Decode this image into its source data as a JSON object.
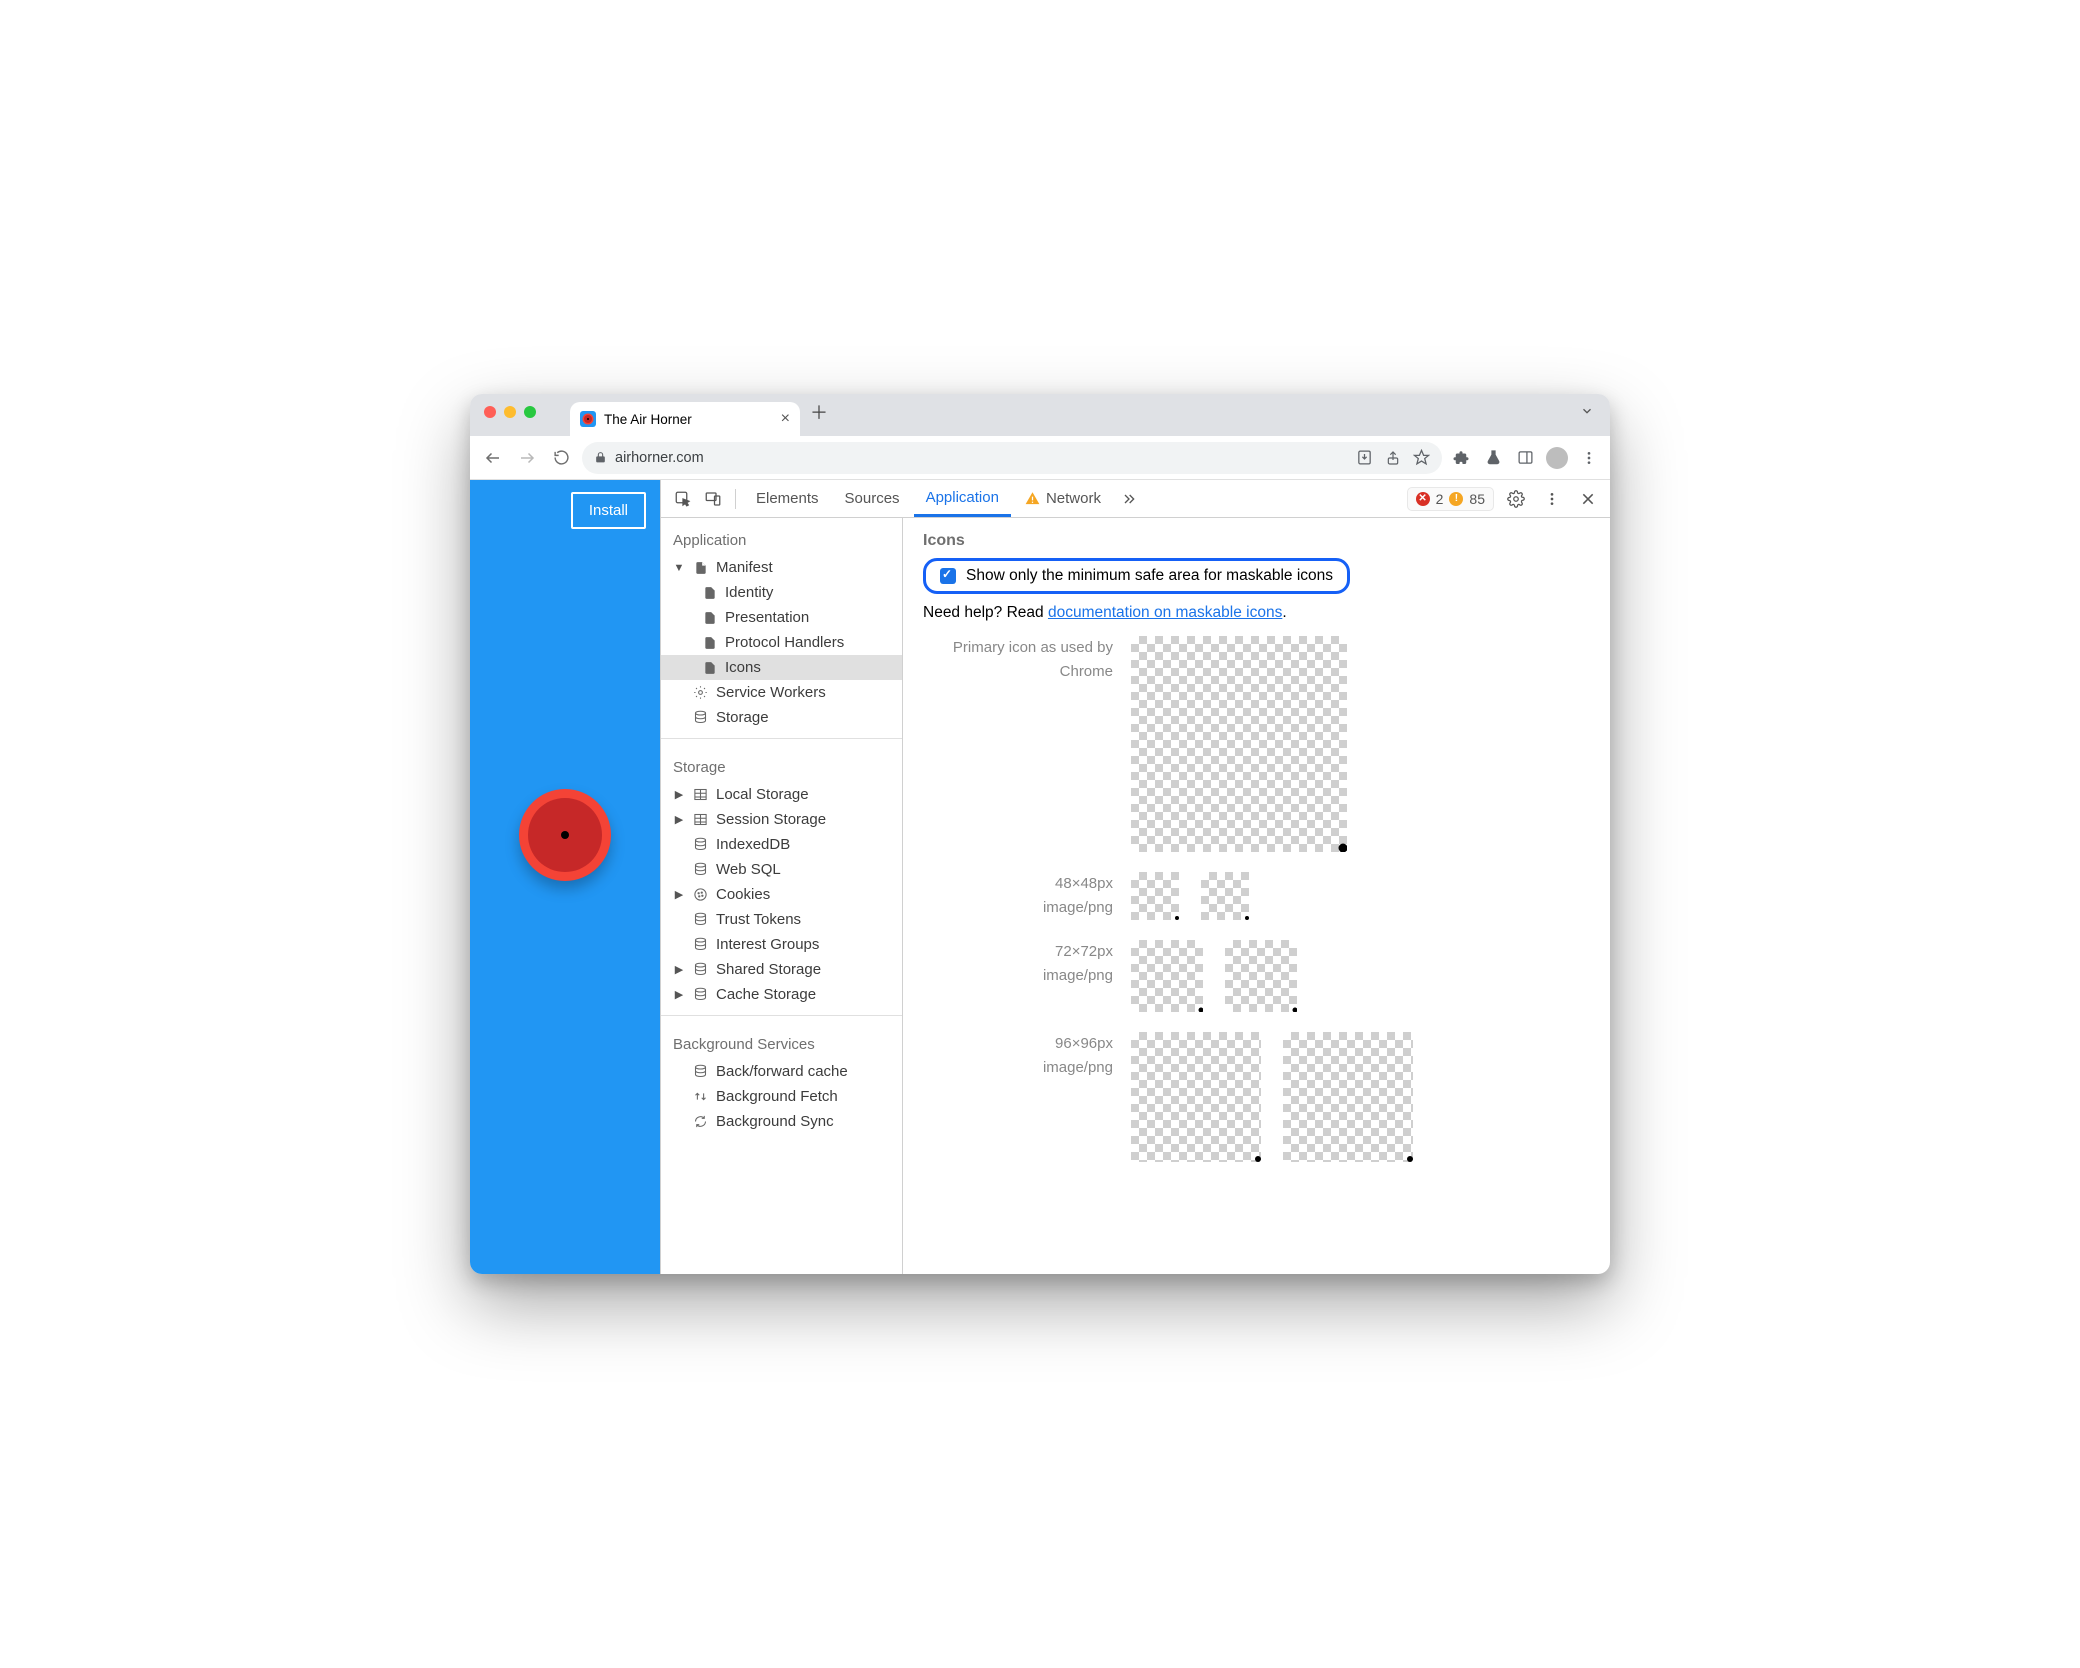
{
  "browser": {
    "tab_title": "The Air Horner",
    "url": "airhorner.com"
  },
  "page": {
    "install_label": "Install"
  },
  "devtools": {
    "tabs": {
      "elements": "Elements",
      "sources": "Sources",
      "application": "Application",
      "network": "Network"
    },
    "errors": {
      "error_count": "2",
      "warning_count": "85"
    }
  },
  "sidebar": {
    "section1": {
      "title": "Application",
      "manifest": "Manifest",
      "identity": "Identity",
      "presentation": "Presentation",
      "protocol_handlers": "Protocol Handlers",
      "icons": "Icons",
      "service_workers": "Service Workers",
      "storage": "Storage"
    },
    "section2": {
      "title": "Storage",
      "local_storage": "Local Storage",
      "session_storage": "Session Storage",
      "indexeddb": "IndexedDB",
      "web_sql": "Web SQL",
      "cookies": "Cookies",
      "trust_tokens": "Trust Tokens",
      "interest_groups": "Interest Groups",
      "shared_storage": "Shared Storage",
      "cache_storage": "Cache Storage"
    },
    "section3": {
      "title": "Background Services",
      "bf_cache": "Back/forward cache",
      "bg_fetch": "Background Fetch",
      "bg_sync": "Background Sync"
    }
  },
  "panel": {
    "title": "Icons",
    "checkbox_label": "Show only the minimum safe area for maskable icons",
    "help_prefix": "Need help? Read ",
    "help_link": "documentation on maskable icons",
    "help_suffix": ".",
    "rows": {
      "primary_label_1": "Primary icon as used by",
      "primary_label_2": "Chrome",
      "r48_size": "48×48px",
      "r48_mime": "image/png",
      "r72_size": "72×72px",
      "r72_mime": "image/png",
      "r96_size": "96×96px",
      "r96_mime": "image/png"
    }
  }
}
